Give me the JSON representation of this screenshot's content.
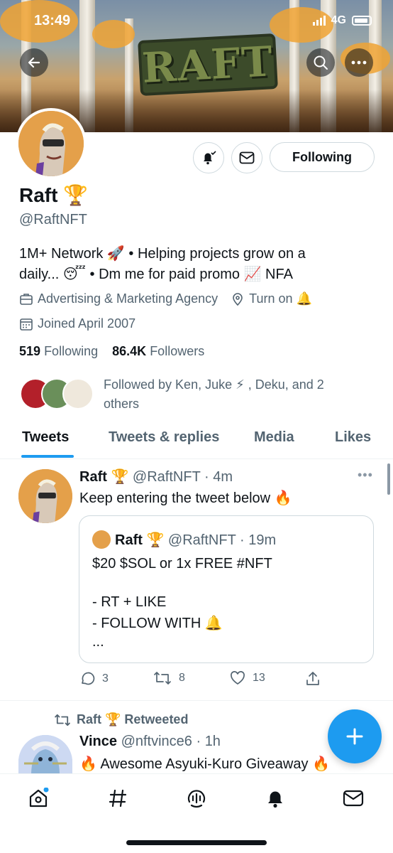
{
  "status_bar": {
    "time": "13:49",
    "network": "4G"
  },
  "banner": {
    "logo_text": "RAFT"
  },
  "profile": {
    "name": "Raft 🏆",
    "handle": "@RaftNFT",
    "bio_line1": "1M+ Network 🚀 • Helping projects grow on a",
    "bio_line2": "daily... 😴 • Dm me for paid promo 📈 NFA",
    "category": "Advertising & Marketing Agency",
    "location": "Turn on 🔔",
    "joined": "Joined April 2007",
    "following_count": "519",
    "following_label": "Following",
    "followers_count": "86.4K",
    "followers_label": "Followers",
    "followed_by_line1": "Followed by Ken, Juke ⚡ , Deku, and 2",
    "followed_by_line2": "others",
    "follow_button": "Following"
  },
  "tabs": [
    "Tweets",
    "Tweets & replies",
    "Media",
    "Likes"
  ],
  "tweet": {
    "name": "Raft 🏆",
    "handle_time": "@RaftNFT · 4m",
    "text": "Keep entering the tweet below 🔥",
    "quote": {
      "name": "Raft 🏆",
      "handle_time": "@RaftNFT · 19m",
      "line1": "$20 $SOL or 1x FREE #NFT",
      "line2": "- RT + LIKE",
      "line3": "- FOLLOW WITH 🔔",
      "line4": "..."
    },
    "replies": "3",
    "retweets": "8",
    "likes": "13"
  },
  "retweet": {
    "label": "Raft 🏆 Retweeted",
    "name": "Vince",
    "handle_time": "@nftvince6 · 1h",
    "text": "🔥 Awesome Asyuki-Kuro Giveaway 🔥"
  },
  "colors": {
    "accent": "#1d9bf0",
    "text": "#0f1419",
    "secondary": "#536471",
    "border": "#cfd9de"
  },
  "icons": [
    "back-arrow-icon",
    "search-icon",
    "more-icon",
    "bell-check-icon",
    "mail-icon",
    "briefcase-icon",
    "location-icon",
    "calendar-icon",
    "reply-icon",
    "retweet-icon",
    "like-icon",
    "share-icon",
    "home-icon",
    "hashtag-icon",
    "spaces-icon",
    "notifications-icon",
    "messages-icon",
    "compose-icon"
  ]
}
